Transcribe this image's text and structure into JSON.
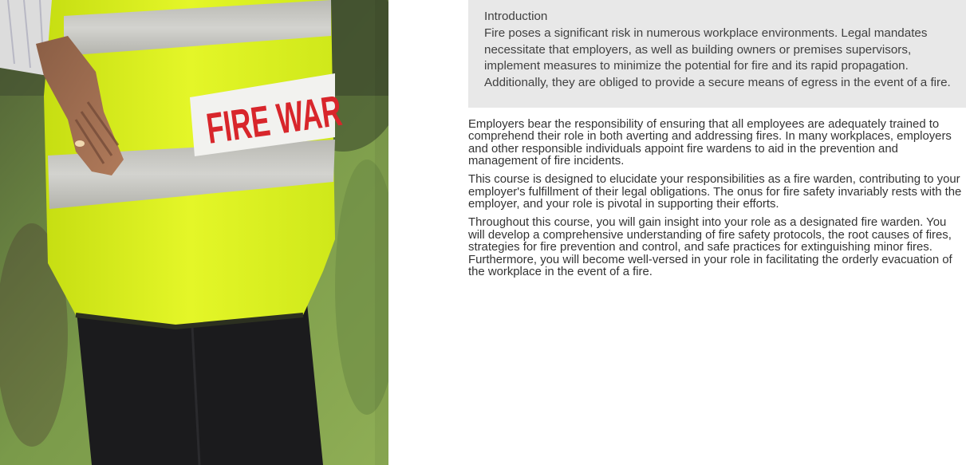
{
  "image": {
    "description_icon": "fire-warden-vest-photo",
    "vest_label": "FIRE WARDEN"
  },
  "intro": {
    "title": "Introduction",
    "text": "Fire poses a significant risk in numerous workplace environments. Legal mandates necessitate that employers, as well as building owners or premises supervisors, implement measures to minimize the potential for fire and its rapid propagation. Additionally, they are obliged to provide a secure means of egress in the event of a fire."
  },
  "body": {
    "paragraphs": [
      "Employers bear the responsibility of ensuring that all employees are adequately trained to comprehend their role in both averting and addressing fires. In many workplaces, employers and other responsible individuals appoint fire wardens to aid in the prevention and management of fire incidents.",
      "This course is designed to elucidate your responsibilities as a fire warden, contributing to your employer's fulfillment of their legal obligations. The onus for fire safety invariably rests with the employer, and your role is pivotal in supporting their efforts.",
      "Throughout this course, you will gain insight into your role as a designated fire warden. You will develop a comprehensive understanding of fire safety protocols, the root causes of fires, strategies for fire prevention and control, and safe practices for extinguishing minor fires. Furthermore, you will become well-versed in your role in facilitating the orderly evacuation of the workplace in the event of a fire."
    ]
  },
  "colors": {
    "intro_bg": "#e8e8e8",
    "vest_yellow": "#d9f21e",
    "reflective_stripe": "#c9c9c4",
    "label_red": "#d8262b"
  }
}
